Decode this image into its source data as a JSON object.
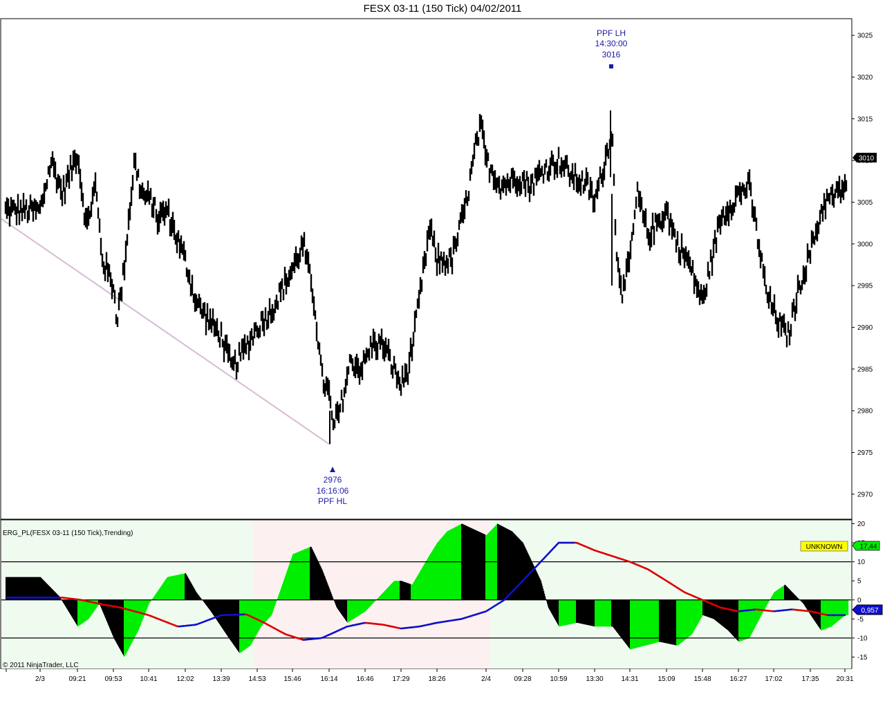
{
  "window": {
    "title": "FESX 03-11 (150 Tick)  04/02/2011"
  },
  "price_panel": {
    "y_ticks": [
      "3025",
      "3020",
      "3015",
      "3010",
      "3005",
      "3000",
      "2995",
      "2990",
      "2985",
      "2980",
      "2975",
      "2970"
    ],
    "last_price": "3010",
    "ppf_lh": {
      "label": "PPF LH",
      "time": "14:30:00",
      "price": "3016"
    },
    "ppf_hl": {
      "label": "PPF HL",
      "time": "16:16:06",
      "price": "2976"
    }
  },
  "indicator_panel": {
    "label": "ERG_PL(FESX 03-11 (150 Tick),Trending)",
    "y_ticks": [
      "20",
      "15",
      "10",
      "5",
      "0",
      "-5",
      "-10",
      "-15"
    ],
    "status_badge": "UNKNOWN",
    "value_badge": "17,44",
    "signal_badge": "0,957",
    "copyright": "© 2011 NinjaTrader, LLC"
  },
  "x_axis": {
    "labels": [
      "2/3",
      "09:21",
      "09:53",
      "10:41",
      "12:02",
      "13:39",
      "14:53",
      "15:46",
      "16:14",
      "16:46",
      "17:29",
      "18:26",
      "2/4",
      "09:28",
      "10:59",
      "13:30",
      "14:31",
      "15:09",
      "15:48",
      "16:27",
      "17:02",
      "17:35",
      "20:31"
    ]
  },
  "colors": {
    "bars": "#000000",
    "histogram_up": "#00ee00",
    "histogram_down": "#000000",
    "signal_red": "#dd0000",
    "signal_blue": "#1010cc",
    "bg_green": "#f0fbf0",
    "bg_pink": "#fdf0f0",
    "trend_line": "#d6bcd6",
    "annotation": "#1a1aa8"
  },
  "chart_data": [
    {
      "type": "ohlc",
      "title": "FESX 03-11 (150 Tick)  04/02/2011",
      "ylim": [
        2967,
        3027
      ],
      "x": [
        "2/3",
        "09:21",
        "09:53",
        "10:41",
        "12:02",
        "13:39",
        "14:53",
        "15:46",
        "16:14",
        "16:46",
        "17:29",
        "18:26",
        "2/4",
        "09:28",
        "10:59",
        "13:30",
        "14:31",
        "15:09",
        "15:48",
        "16:27",
        "17:02",
        "17:35",
        "20:31"
      ],
      "anchors": [
        [
          0,
          3004
        ],
        [
          0.3,
          3010
        ],
        [
          0.6,
          3006
        ],
        [
          1.0,
          3011
        ],
        [
          1.25,
          3002
        ],
        [
          1.5,
          3007
        ],
        [
          1.7,
          2998
        ],
        [
          2.0,
          2995
        ],
        [
          2.1,
          2991
        ],
        [
          2.25,
          2995
        ],
        [
          2.6,
          3010
        ],
        [
          2.8,
          3006
        ],
        [
          3.1,
          3005
        ],
        [
          3.25,
          3003
        ],
        [
          3.5,
          3004
        ],
        [
          4.0,
          2998
        ],
        [
          4.3,
          2993
        ],
        [
          4.8,
          2990
        ],
        [
          5.0,
          2989
        ],
        [
          5.3,
          2985
        ],
        [
          5.6,
          2987
        ],
        [
          6.0,
          2990
        ],
        [
          6.4,
          2992
        ],
        [
          7.0,
          2997
        ],
        [
          7.3,
          3000
        ],
        [
          7.6,
          2993
        ],
        [
          7.8,
          2984
        ],
        [
          8.0,
          2982
        ],
        [
          8.1,
          2978
        ],
        [
          8.3,
          2980
        ],
        [
          8.6,
          2986
        ],
        [
          8.9,
          2985
        ],
        [
          9.2,
          2988
        ],
        [
          9.5,
          2988
        ],
        [
          9.8,
          2985
        ],
        [
          10.0,
          2983
        ],
        [
          10.2,
          2985
        ],
        [
          10.4,
          2990
        ],
        [
          10.8,
          3002
        ],
        [
          11.0,
          2998
        ],
        [
          11.3,
          2998
        ],
        [
          11.6,
          3005
        ],
        [
          11.8,
          3012
        ],
        [
          11.9,
          3014
        ],
        [
          12.0,
          3010
        ],
        [
          12.4,
          3007
        ],
        [
          12.9,
          3008
        ],
        [
          13.2,
          3007
        ],
        [
          13.6,
          3009
        ],
        [
          14.0,
          3010
        ],
        [
          14.4,
          3008
        ],
        [
          14.8,
          3007
        ],
        [
          15.0,
          3005
        ],
        [
          15.3,
          3010
        ],
        [
          15.5,
          3014
        ],
        [
          15.6,
          3000
        ],
        [
          15.8,
          2994
        ],
        [
          16.0,
          2998
        ],
        [
          16.2,
          3006
        ],
        [
          16.5,
          3001
        ],
        [
          17.0,
          3004
        ],
        [
          17.3,
          3000
        ],
        [
          17.6,
          2998
        ],
        [
          18.0,
          2993
        ],
        [
          18.2,
          2997
        ],
        [
          18.5,
          3003
        ],
        [
          19.0,
          3006
        ],
        [
          19.3,
          3007
        ],
        [
          19.5,
          3002
        ],
        [
          19.8,
          2994
        ],
        [
          20.2,
          2990
        ],
        [
          20.4,
          2989
        ],
        [
          20.7,
          2995
        ],
        [
          21.0,
          2999
        ],
        [
          21.4,
          3005
        ],
        [
          21.8,
          3006
        ],
        [
          22.0,
          3007
        ],
        [
          22.1,
          3008
        ],
        [
          22.3,
          3009
        ],
        [
          22.5,
          3010
        ]
      ],
      "last_price": 3010,
      "annotations": [
        {
          "label": "PPF LH",
          "time": "14:30:00",
          "price": 3016
        },
        {
          "label": "PPF HL",
          "time": "16:16:06",
          "price": 2976
        }
      ],
      "trend_line": [
        [
          0,
          3003
        ],
        [
          8.0,
          2976
        ]
      ]
    },
    {
      "type": "area",
      "title": "ERG_PL(FESX 03-11 (150 Tick),Trending)",
      "ylim": [
        -18,
        21
      ],
      "levels": [
        10,
        0,
        -10
      ],
      "x": [
        "2/3",
        "09:21",
        "09:53",
        "10:41",
        "12:02",
        "13:39",
        "14:53",
        "15:46",
        "16:14",
        "16:46",
        "17:29",
        "18:26",
        "2/4",
        "09:28",
        "10:59",
        "13:30",
        "14:31",
        "15:09",
        "15:48",
        "16:27",
        "17:02",
        "17:35",
        "20:31"
      ],
      "background_regions": [
        {
          "from": 0,
          "to": 6.0,
          "zone": "green"
        },
        {
          "from": 6.0,
          "to": 12.1,
          "zone": "pink"
        },
        {
          "from": 12.1,
          "to": 22.9,
          "zone": "green"
        }
      ],
      "series": [
        {
          "kind": "histogram",
          "anchors": [
            [
              0,
              6
            ],
            [
              0.5,
              1
            ],
            [
              1.0,
              -7
            ],
            [
              1.3,
              -5
            ],
            [
              1.6,
              -1
            ],
            [
              2.0,
              -10
            ],
            [
              2.3,
              -15
            ],
            [
              2.7,
              -8
            ],
            [
              3.0,
              -1
            ],
            [
              3.5,
              6
            ],
            [
              4.0,
              7
            ],
            [
              4.3,
              2
            ],
            [
              4.7,
              -3
            ],
            [
              5.2,
              -10
            ],
            [
              5.5,
              -14
            ],
            [
              5.8,
              -12
            ],
            [
              6.1,
              -7
            ],
            [
              6.4,
              -4
            ],
            [
              6.7,
              4
            ],
            [
              7.0,
              12
            ],
            [
              7.5,
              14
            ],
            [
              7.8,
              8
            ],
            [
              8.2,
              -2
            ],
            [
              8.5,
              -6
            ],
            [
              9.0,
              -3
            ],
            [
              9.5,
              2
            ],
            [
              9.8,
              5
            ],
            [
              10.0,
              5
            ],
            [
              10.3,
              4
            ],
            [
              10.8,
              12
            ],
            [
              11.2,
              18
            ],
            [
              11.5,
              20
            ],
            [
              12.0,
              17
            ],
            [
              12.3,
              20
            ],
            [
              12.7,
              18
            ],
            [
              13.0,
              15
            ],
            [
              13.5,
              5
            ],
            [
              13.7,
              -2
            ],
            [
              14.0,
              -7
            ],
            [
              14.5,
              -6
            ],
            [
              15.0,
              -7
            ],
            [
              15.5,
              -7
            ],
            [
              16.0,
              -13
            ],
            [
              16.4,
              -12
            ],
            [
              16.8,
              -11
            ],
            [
              17.3,
              -12
            ],
            [
              17.7,
              -9
            ],
            [
              18.0,
              -4
            ],
            [
              18.3,
              -5
            ],
            [
              18.7,
              -8
            ],
            [
              19.0,
              -11
            ],
            [
              19.3,
              -10
            ],
            [
              19.7,
              -3
            ],
            [
              20.0,
              2
            ],
            [
              20.3,
              4
            ],
            [
              20.5,
              2
            ],
            [
              20.8,
              -1
            ],
            [
              21.0,
              -4
            ],
            [
              21.3,
              -8
            ],
            [
              21.6,
              -7
            ],
            [
              22.0,
              -4
            ],
            [
              22.5,
              5
            ],
            [
              22.8,
              15
            ],
            [
              22.9,
              17.4
            ]
          ]
        },
        {
          "kind": "signal",
          "anchors": [
            [
              0,
              0.6
            ],
            [
              0.6,
              0.6
            ],
            [
              1.1,
              0
            ],
            [
              1.7,
              -1.2
            ],
            [
              2.2,
              -2
            ],
            [
              3.0,
              -4
            ],
            [
              3.8,
              -7
            ],
            [
              4.3,
              -6.5
            ],
            [
              5.0,
              -4
            ],
            [
              5.7,
              -3.8
            ],
            [
              6.2,
              -6
            ],
            [
              6.8,
              -9
            ],
            [
              7.3,
              -10.5
            ],
            [
              7.8,
              -10
            ],
            [
              8.5,
              -7
            ],
            [
              9.0,
              -6
            ],
            [
              9.5,
              -6.5
            ],
            [
              10.0,
              -7.5
            ],
            [
              10.5,
              -7
            ],
            [
              11.5,
              -5
            ],
            [
              12.0,
              -3
            ],
            [
              12.5,
              0
            ],
            [
              13.0,
              5
            ],
            [
              13.5,
              10
            ],
            [
              14.0,
              15
            ],
            [
              14.5,
              15
            ],
            [
              15.0,
              13
            ],
            [
              16.0,
              10
            ],
            [
              16.5,
              8
            ],
            [
              17.0,
              5
            ],
            [
              17.5,
              2
            ],
            [
              18.0,
              0
            ],
            [
              18.5,
              -2
            ],
            [
              19.0,
              -3
            ],
            [
              19.5,
              -2.5
            ],
            [
              20.0,
              -3
            ],
            [
              20.5,
              -2.5
            ],
            [
              21.0,
              -3
            ],
            [
              21.5,
              -4
            ],
            [
              22.0,
              -4
            ],
            [
              22.5,
              -3
            ],
            [
              22.9,
              0.96
            ]
          ]
        }
      ]
    }
  ]
}
